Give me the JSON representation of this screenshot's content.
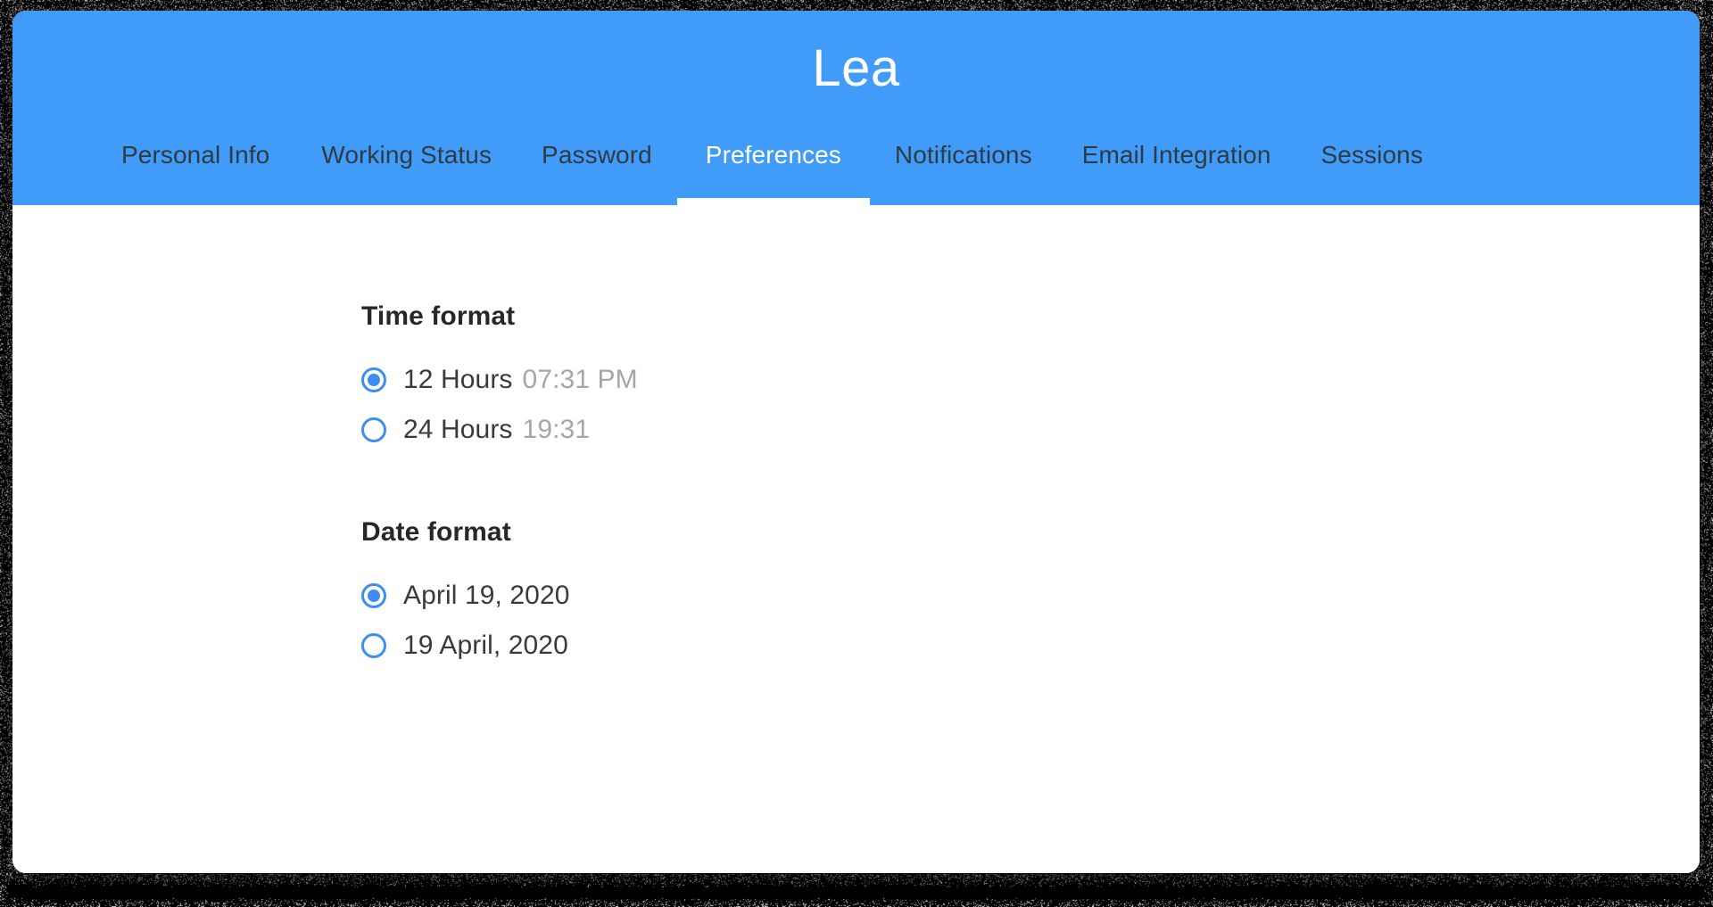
{
  "theme": {
    "header_blue": "#419bf9",
    "accent_blue": "#3d8ef0",
    "tab_inactive_text": "#2f3b44",
    "tab_active_text": "#ffffff",
    "heading_text": "#272727",
    "body_text": "#3a3a3a",
    "muted_text": "#a6a6a6",
    "card_background": "#ffffff",
    "page_background": "#000000"
  },
  "header": {
    "title": "Lea"
  },
  "tabs": [
    {
      "id": "personal-info",
      "label": "Personal Info",
      "active": false
    },
    {
      "id": "working-status",
      "label": "Working Status",
      "active": false
    },
    {
      "id": "password",
      "label": "Password",
      "active": false
    },
    {
      "id": "preferences",
      "label": "Preferences",
      "active": true
    },
    {
      "id": "notifications",
      "label": "Notifications",
      "active": false
    },
    {
      "id": "email-integration",
      "label": "Email Integration",
      "active": false
    },
    {
      "id": "sessions",
      "label": "Sessions",
      "active": false
    }
  ],
  "preferences": {
    "time_format": {
      "heading": "Time format",
      "options": [
        {
          "id": "12-hours",
          "label": "12 Hours",
          "hint": "07:31 PM",
          "selected": true
        },
        {
          "id": "24-hours",
          "label": "24 Hours",
          "hint": "19:31",
          "selected": false
        }
      ]
    },
    "date_format": {
      "heading": "Date format",
      "options": [
        {
          "id": "month-day-year",
          "label": "April 19, 2020",
          "hint": "",
          "selected": true
        },
        {
          "id": "day-month-year",
          "label": "19 April, 2020",
          "hint": "",
          "selected": false
        }
      ]
    }
  }
}
